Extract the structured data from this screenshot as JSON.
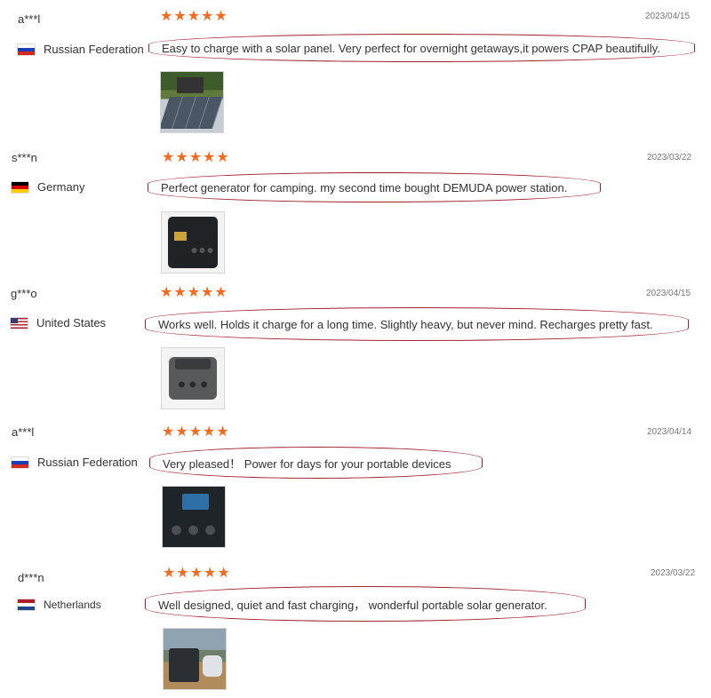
{
  "reviews": [
    {
      "user": "a***l",
      "country": "Russian Federation",
      "flag": "flag-ru",
      "rating": 5,
      "date": "2023/04/15",
      "comment": "Easy to charge with a solar panel. Very perfect for overnight getaways,it powers CPAP beautifully.",
      "photo": "solar-panel-photo"
    },
    {
      "user": "s***n",
      "country": "Germany",
      "flag": "flag-de",
      "rating": 5,
      "date": "2023/03/22",
      "comment": "Perfect generator for camping. my second time bought DEMUDA power station.",
      "photo": "power-station-photo"
    },
    {
      "user": "g***o",
      "country": "United States",
      "flag": "flag-us",
      "rating": 5,
      "date": "2023/04/15",
      "comment": "Works well. Holds it charge for a long time. Slightly heavy, but never mind. Recharges pretty fast.",
      "photo": "power-station-photo"
    },
    {
      "user": "a***l",
      "country": "Russian Federation",
      "flag": "flag-ru",
      "rating": 5,
      "date": "2023/04/14",
      "comment": "Very pleased！ Power for days for your portable devices",
      "photo": "power-station-photo"
    },
    {
      "user": "d***n",
      "country": "Netherlands",
      "flag": "flag-nl",
      "rating": 5,
      "date": "2023/03/22",
      "comment": "Well designed, quiet and fast charging， wonderful portable solar generator.",
      "photo": "outdoor-generator-photo"
    }
  ],
  "colors": {
    "star": "#f36c21",
    "highlight_border": "#a0202c"
  },
  "icons": {
    "star": "star-icon"
  }
}
